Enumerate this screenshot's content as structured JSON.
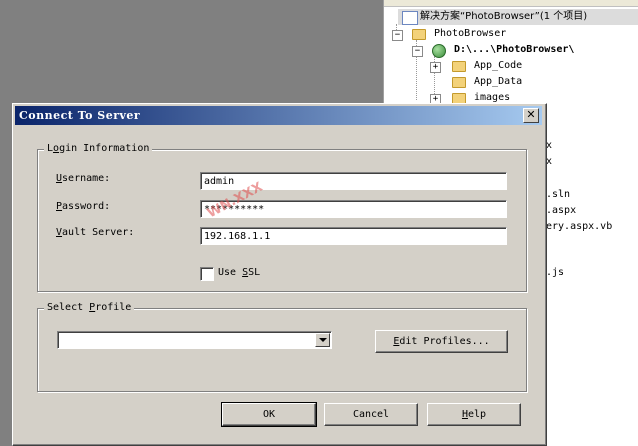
{
  "explorer": {
    "solution_label": "解决方案“PhotoBrowser”(1 个项目)",
    "project_label": "PhotoBrowser",
    "site_path": "D:\\...\\PhotoBrowser\\",
    "folders": [
      "App_Code",
      "App_Data",
      "images"
    ],
    "partial_items": [
      "x",
      "x",
      ".sln",
      ".aspx",
      "ery.aspx.vb",
      ".js"
    ]
  },
  "dialog": {
    "title": "Connect To Server",
    "close_glyph": "✕",
    "login_group": {
      "legend_prefix": "L",
      "legend_accel": "o",
      "legend_suffix": "gin Information",
      "username": {
        "accel": "U",
        "rest": "sername:",
        "value": "admin"
      },
      "password": {
        "accel": "P",
        "rest": "assword:",
        "value": "**********"
      },
      "vault": {
        "accel": "V",
        "rest": "ault Server:",
        "value": "192.168.1.1"
      },
      "use_ssl": {
        "prefix": "Use ",
        "accel": "S",
        "suffix": "SL",
        "checked": false
      }
    },
    "profile_group": {
      "legend_prefix": "Select ",
      "legend_accel": "P",
      "legend_suffix": "rofile",
      "selected": "",
      "edit_btn": {
        "accel": "E",
        "rest": "dit Profiles..."
      }
    },
    "buttons": {
      "ok": "OK",
      "cancel": "Cancel",
      "help_accel": "H",
      "help_rest": "elp"
    },
    "watermark": "WN.XXX"
  }
}
